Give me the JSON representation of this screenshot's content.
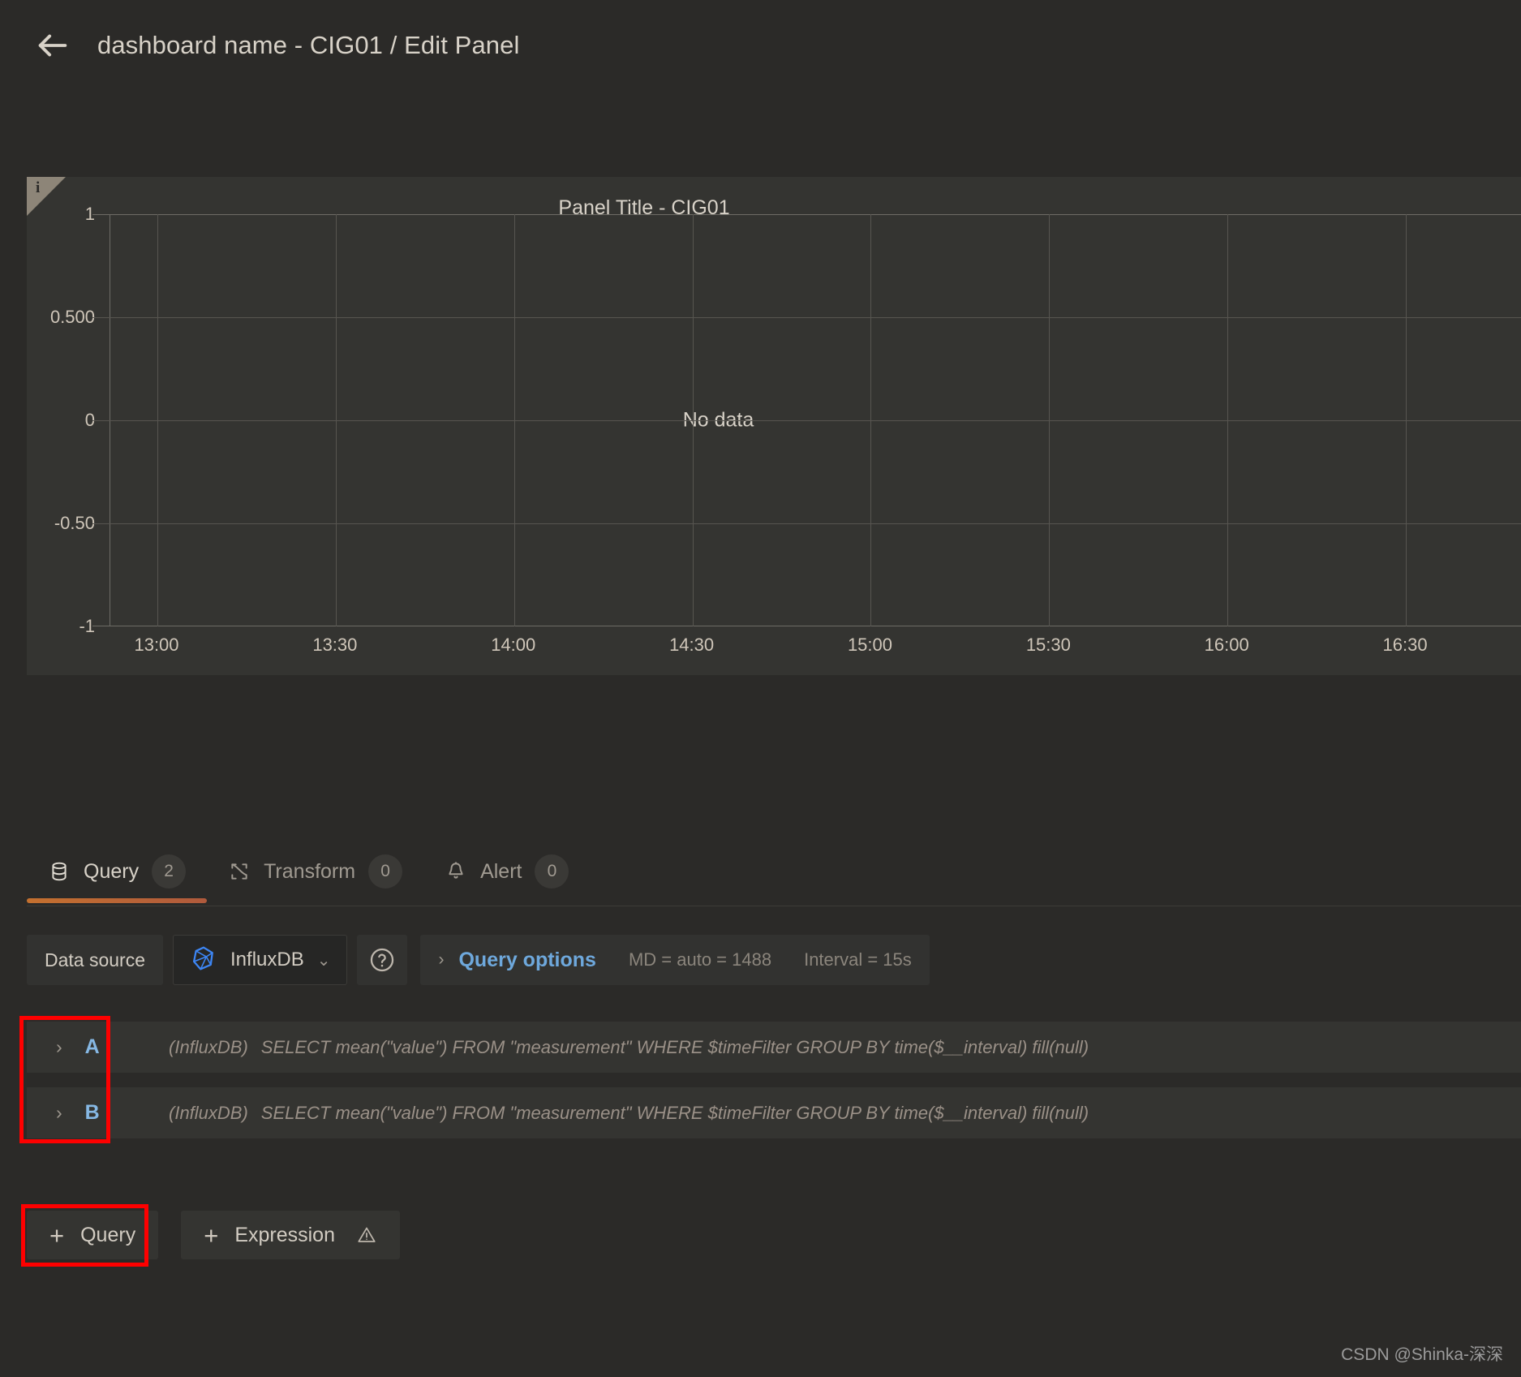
{
  "header": {
    "back_icon": "arrow-left-icon",
    "breadcrumb": "dashboard name - CIG01 / Edit Panel"
  },
  "panel": {
    "corner_info_glyph": "i",
    "title": "Panel Title - CIG01",
    "no_data_text": "No data"
  },
  "chart_data": {
    "type": "line",
    "title": "Panel Title - CIG01",
    "xlabel": "",
    "ylabel": "",
    "series": [],
    "x_tick_labels": [
      "13:00",
      "13:30",
      "14:00",
      "14:30",
      "15:00",
      "15:30",
      "16:00",
      "16:30"
    ],
    "y_tick_labels": [
      "1",
      "0.500",
      "0",
      "-0.50",
      "-1"
    ],
    "y_tick_values": [
      1,
      0.5,
      0,
      -0.5,
      -1
    ],
    "ylim": [
      -1,
      1
    ],
    "grid": true,
    "legend": "none",
    "empty_state": "No data"
  },
  "tabs": [
    {
      "label": "Query",
      "count": "2",
      "icon": "database-icon",
      "active": true
    },
    {
      "label": "Transform",
      "count": "0",
      "icon": "transform-icon",
      "active": false
    },
    {
      "label": "Alert",
      "count": "0",
      "icon": "bell-icon",
      "active": false
    }
  ],
  "datasource": {
    "label": "Data source",
    "selected": "InfluxDB",
    "chevron": "⌄",
    "datasource_icon": "influxdb-icon",
    "help_icon": "help-circle-icon"
  },
  "query_options": {
    "chevron": "›",
    "label": "Query options",
    "max_data_points": "MD = auto = 1488",
    "interval": "Interval = 15s"
  },
  "queries": [
    {
      "ref": "A",
      "chevron": "›",
      "datasource": "(InfluxDB)",
      "expression": "SELECT mean(\"value\") FROM \"measurement\" WHERE $timeFilter GROUP BY time($__interval) fill(null)"
    },
    {
      "ref": "B",
      "chevron": "›",
      "datasource": "(InfluxDB)",
      "expression": "SELECT mean(\"value\") FROM \"measurement\" WHERE $timeFilter GROUP BY time($__interval) fill(null)"
    }
  ],
  "buttons": {
    "add_query": {
      "plus": "+",
      "label": "Query"
    },
    "add_expression": {
      "plus": "+",
      "label": "Expression",
      "warn_icon": "warning-triangle-icon"
    }
  },
  "annotations": {
    "highlight_color": "#fe0000"
  },
  "watermark": "CSDN @Shinka-深深"
}
